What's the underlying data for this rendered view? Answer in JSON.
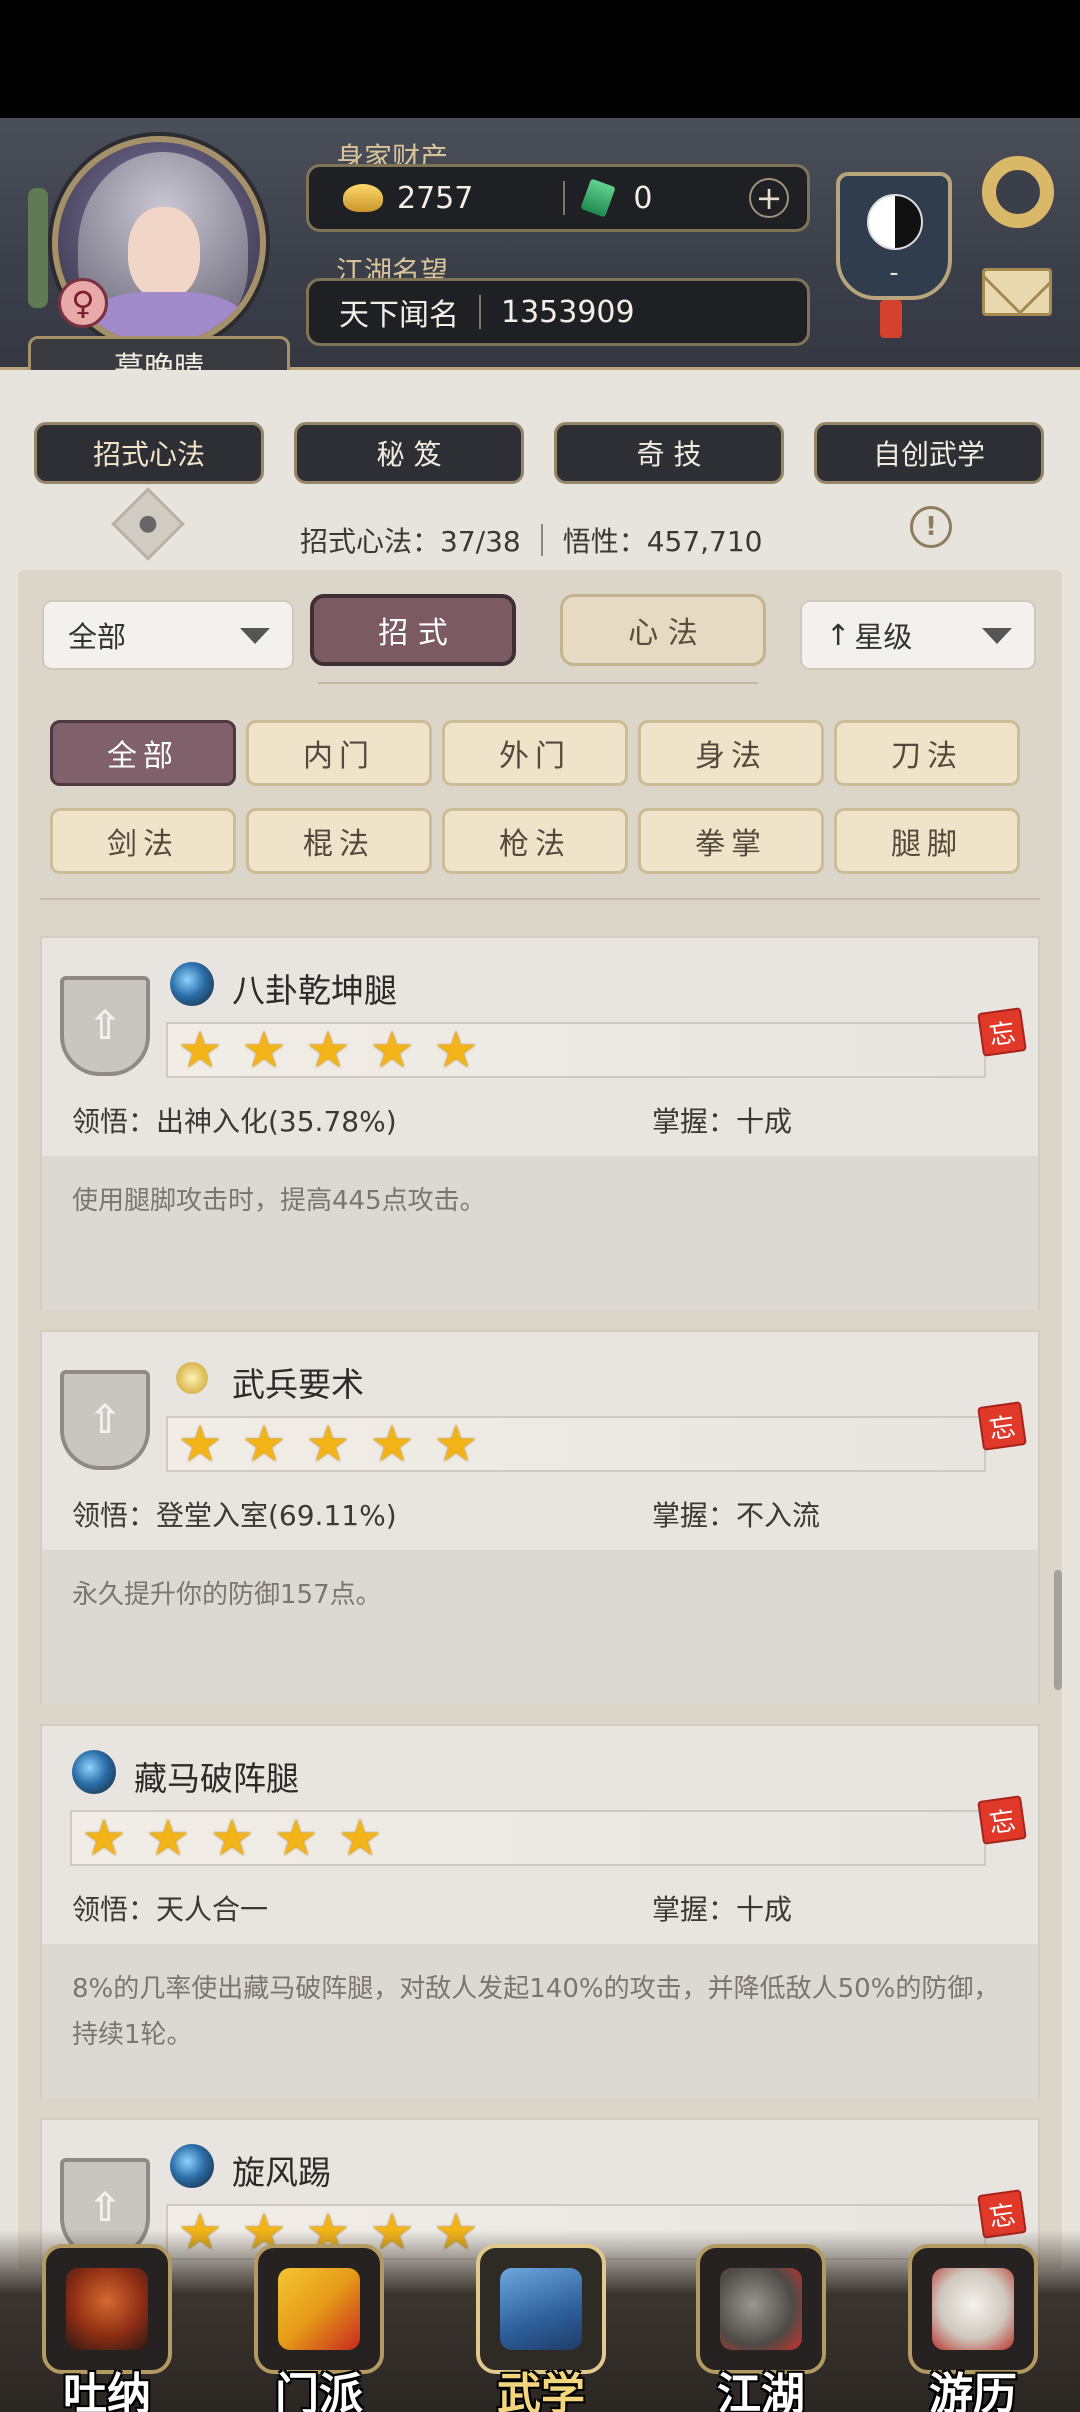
{
  "header": {
    "wealth_label": "身家财产",
    "gold_amount": "2757",
    "jade_amount": "0",
    "plus_symbol": "+",
    "fame_label": "江湖名望",
    "fame_title": "天下闻名",
    "fame_value": "1353909",
    "character_name": "慕晚晴",
    "gender_symbol": "♀",
    "shield_text": "-"
  },
  "tabs": [
    {
      "label": "招式心法",
      "active": true
    },
    {
      "label": "秘 笈",
      "active": false
    },
    {
      "label": "奇 技",
      "active": false
    },
    {
      "label": "自创武学",
      "active": false
    }
  ],
  "stats": {
    "moves_text": "招式心法：37/38",
    "insight_text": "悟性：457,710"
  },
  "filters": {
    "category_dropdown": "全部",
    "segment_moves": "招 式",
    "segment_mental": "心 法",
    "sort_dropdown": "星级",
    "sort_arrow": "↑"
  },
  "chips": [
    {
      "label": "全部",
      "active": true
    },
    {
      "label": "内门",
      "active": false
    },
    {
      "label": "外门",
      "active": false
    },
    {
      "label": "身法",
      "active": false
    },
    {
      "label": "刀法",
      "active": false
    },
    {
      "label": "剑法",
      "active": false
    },
    {
      "label": "棍法",
      "active": false
    },
    {
      "label": "枪法",
      "active": false
    },
    {
      "label": "拳掌",
      "active": false
    },
    {
      "label": "腿脚",
      "active": false
    }
  ],
  "skills": [
    {
      "name": "八卦乾坤腿",
      "stars": 5,
      "comprehension": "领悟：出神入化(35.78%)",
      "mastery": "掌握：十成",
      "description": "使用腿脚攻击时，提高445点攻击。",
      "forget_label": "忘"
    },
    {
      "name": "武兵要术",
      "stars": 5,
      "comprehension": "领悟：登堂入室(69.11%)",
      "mastery": "掌握：不入流",
      "description": "永久提升你的防御157点。",
      "forget_label": "忘"
    },
    {
      "name": "藏马破阵腿",
      "stars": 5,
      "comprehension": "领悟：天人合一",
      "mastery": "掌握：十成",
      "description": "8%的几率使出藏马破阵腿，对敌人发起140%的攻击，并降低敌人50%的防御，持续1轮。",
      "forget_label": "忘"
    },
    {
      "name": "旋风踢",
      "stars": 5,
      "comprehension": "",
      "mastery": "",
      "description": "",
      "forget_label": "忘"
    }
  ],
  "bottom_nav": [
    {
      "label": "吐纳",
      "active": false
    },
    {
      "label": "门派",
      "active": false
    },
    {
      "label": "武学",
      "active": true
    },
    {
      "label": "江湖",
      "active": false
    },
    {
      "label": "游历",
      "active": false
    }
  ],
  "colors": {
    "header_bg": "#3b3f49",
    "accent_gold": "#d7c49b",
    "active_segment": "#7b5a61",
    "star": "#f2b418",
    "forget_seal": "#e0392a"
  }
}
